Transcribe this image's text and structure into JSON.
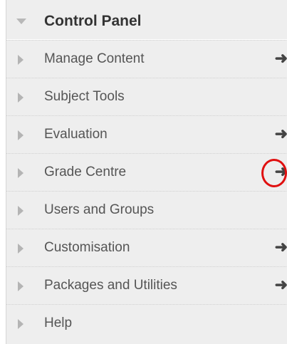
{
  "panel": {
    "title": "Control Panel",
    "items": [
      {
        "label": "Manage Content",
        "arrow": "➜",
        "has_arrow": true
      },
      {
        "label": "Subject Tools",
        "arrow": "",
        "has_arrow": false
      },
      {
        "label": "Evaluation",
        "arrow": "➜",
        "has_arrow": true
      },
      {
        "label": "Grade Centre",
        "arrow": "➜",
        "has_arrow": true
      },
      {
        "label": "Users and Groups",
        "arrow": "",
        "has_arrow": false
      },
      {
        "label": "Customisation",
        "arrow": "➜",
        "has_arrow": true
      },
      {
        "label": "Packages and Utilities",
        "arrow": "➜",
        "has_arrow": true
      },
      {
        "label": "Help",
        "arrow": "",
        "has_arrow": false
      }
    ]
  },
  "colors": {
    "panel_bg": "#eeeeee",
    "highlight": "#e01010",
    "title_text": "#333333",
    "item_text": "#555555"
  },
  "icons": {
    "header_expander": "caret-down-icon",
    "item_expander": "caret-right-icon",
    "item_link": "arrow-right-icon"
  }
}
